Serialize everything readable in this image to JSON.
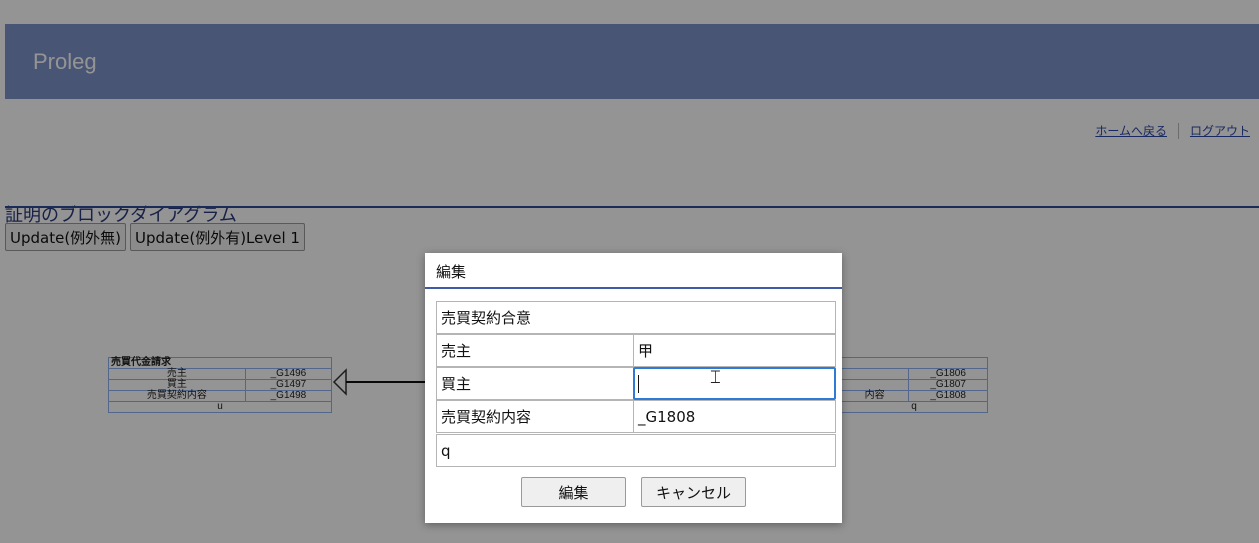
{
  "header": {
    "brand": "Proleg"
  },
  "nav": {
    "home_link": "ホームへ戻る",
    "logout_link": "ログアウト"
  },
  "page": {
    "title": "証明のブロックダイアグラム"
  },
  "toolbar": {
    "update_no_exception": "Update(例外無)",
    "update_with_exception": "Update(例外有)Level 1"
  },
  "diagram": {
    "left_block": {
      "title": "売買代金請求",
      "rows": [
        {
          "label": "売主",
          "value": "_G1496"
        },
        {
          "label": "買主",
          "value": "_G1497"
        },
        {
          "label": "売買契約内容",
          "value": "_G1498"
        }
      ],
      "footer": "u"
    },
    "right_block": {
      "rows": [
        {
          "label": "",
          "value": "_G1806"
        },
        {
          "label": "",
          "value": "_G1807"
        },
        {
          "label": "内容",
          "value": "_G1808"
        }
      ],
      "footer": "q"
    }
  },
  "modal": {
    "title": "編集",
    "name_value": "売買契約合意",
    "seller_label": "売主",
    "seller_value": "甲",
    "buyer_label": "買主",
    "buyer_value": "",
    "contract_label": "売買契約内容",
    "contract_value": "_G1808",
    "footer_value": "q",
    "edit_button": "編集",
    "cancel_button": "キャンセル"
  }
}
